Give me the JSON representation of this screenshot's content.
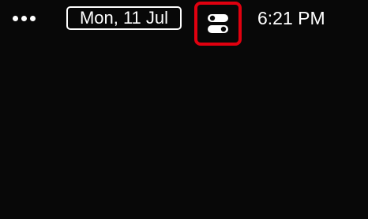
{
  "menubar": {
    "overflow_icon": "more-dots-icon",
    "date": "Mon, 11 Jul",
    "control_center_icon": "control-center-toggle-icon",
    "highlight_color": "#e0000f",
    "time": "6:21 PM"
  },
  "desktop": {
    "background_color": "#080808"
  }
}
